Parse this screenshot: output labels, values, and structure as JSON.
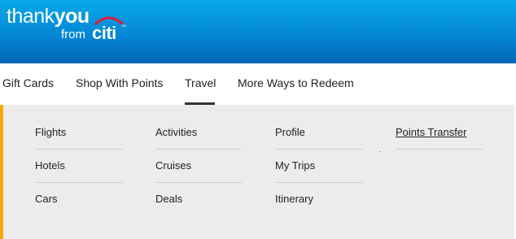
{
  "header": {
    "logo": {
      "thank": "thank",
      "you": "you",
      "from": "from",
      "citi": "citi",
      "tm": "SM",
      "accent_color": "#e31837"
    }
  },
  "nav": {
    "items": [
      {
        "label": "Gift Cards"
      },
      {
        "label": "Shop With Points"
      },
      {
        "label": "Travel",
        "active": true
      },
      {
        "label": "More Ways to Redeem"
      }
    ]
  },
  "dropdown": {
    "accent_color": "#f5a800",
    "columns": [
      {
        "links": [
          "Flights",
          "Hotels",
          "Cars"
        ]
      },
      {
        "links": [
          "Activities",
          "Cruises",
          "Deals"
        ]
      },
      {
        "links": [
          "Profile",
          "My Trips",
          "Itinerary"
        ]
      },
      {
        "links": [
          "Points Transfer"
        ]
      }
    ]
  }
}
